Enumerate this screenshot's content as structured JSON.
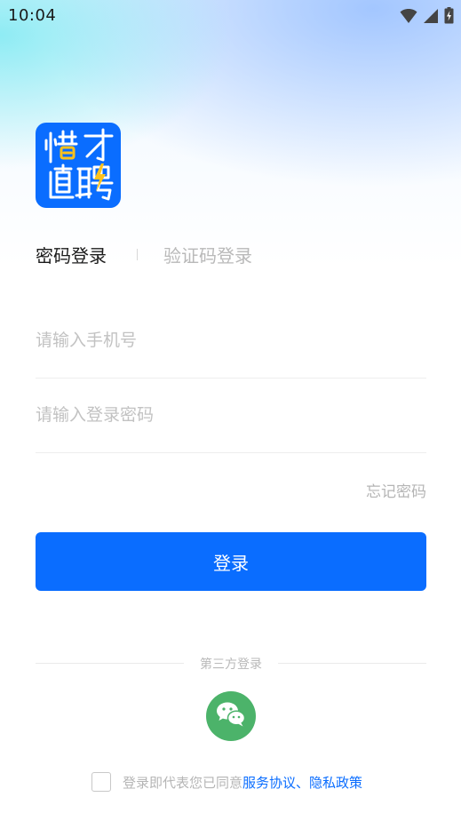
{
  "status_bar": {
    "time": "10:04",
    "icons": [
      "wifi-icon",
      "cellular-signal-icon",
      "battery-charging-icon"
    ]
  },
  "logo": {
    "line1": "惜才",
    "line2": "直聘",
    "brand_color": "#0a6dff"
  },
  "tabs": {
    "password_login": "密码登录",
    "sms_login": "验证码登录",
    "active": "password_login"
  },
  "form": {
    "phone": {
      "value": "",
      "placeholder": "请输入手机号"
    },
    "password": {
      "value": "",
      "placeholder": "请输入登录密码"
    },
    "forgot_password": "忘记密码",
    "submit_label": "登录"
  },
  "third_party": {
    "label": "第三方登录",
    "providers": [
      "wechat-icon"
    ],
    "wechat_color": "#4cb36a"
  },
  "agreement": {
    "checked": false,
    "prefix": "登录即代表您已同意",
    "service_agreement": "服务协议",
    "separator": "、",
    "privacy_policy": "隐私政策",
    "link_color": "#0a6dff"
  }
}
